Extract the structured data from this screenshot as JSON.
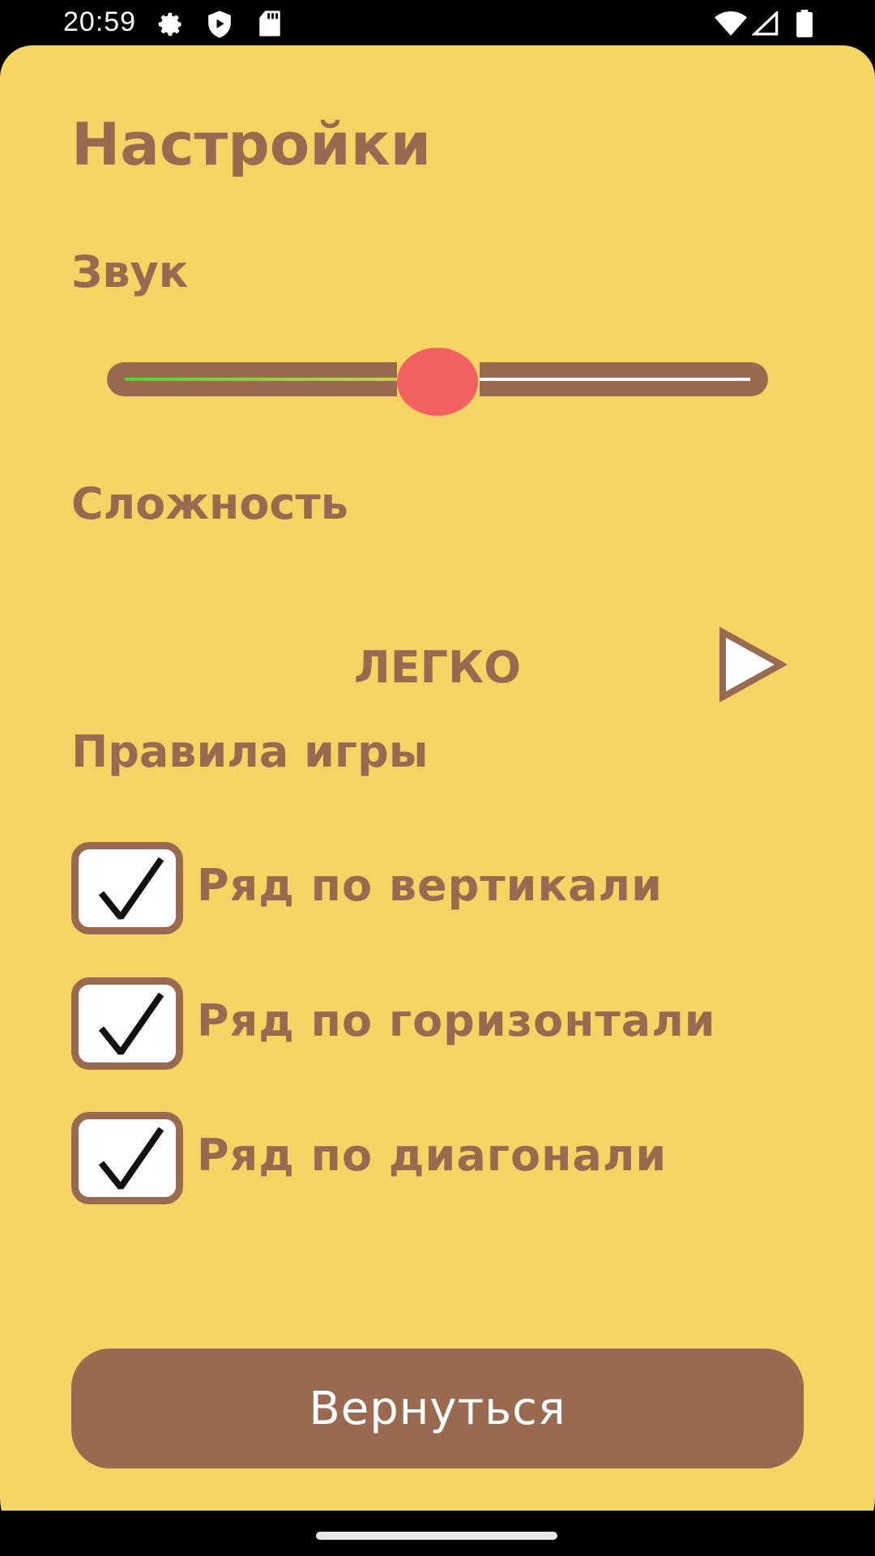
{
  "status_bar": {
    "time": "20:59",
    "icons": [
      "settings-gear-icon",
      "shield-play-icon",
      "sd-card-icon",
      "wifi-icon",
      "signal-icon",
      "battery-icon"
    ]
  },
  "colors": {
    "background": "#f4d462",
    "accent": "#9a6a50",
    "thumb": "#f26060",
    "slider_fill": "#4cd62a",
    "checkbox_bg": "#ffffff"
  },
  "screen": {
    "title": "Настройки",
    "sound": {
      "label": "Звук",
      "volume_fraction": 0.5
    },
    "difficulty": {
      "label": "Сложность",
      "value": "ЛЕГКО"
    },
    "rules": {
      "label": "Правила игры",
      "items": [
        {
          "label": "Ряд по вертикали",
          "checked": true
        },
        {
          "label": "Ряд по горизонтали",
          "checked": true
        },
        {
          "label": "Ряд по диагонали",
          "checked": true
        }
      ]
    },
    "back_button_label": "Вернуться"
  }
}
